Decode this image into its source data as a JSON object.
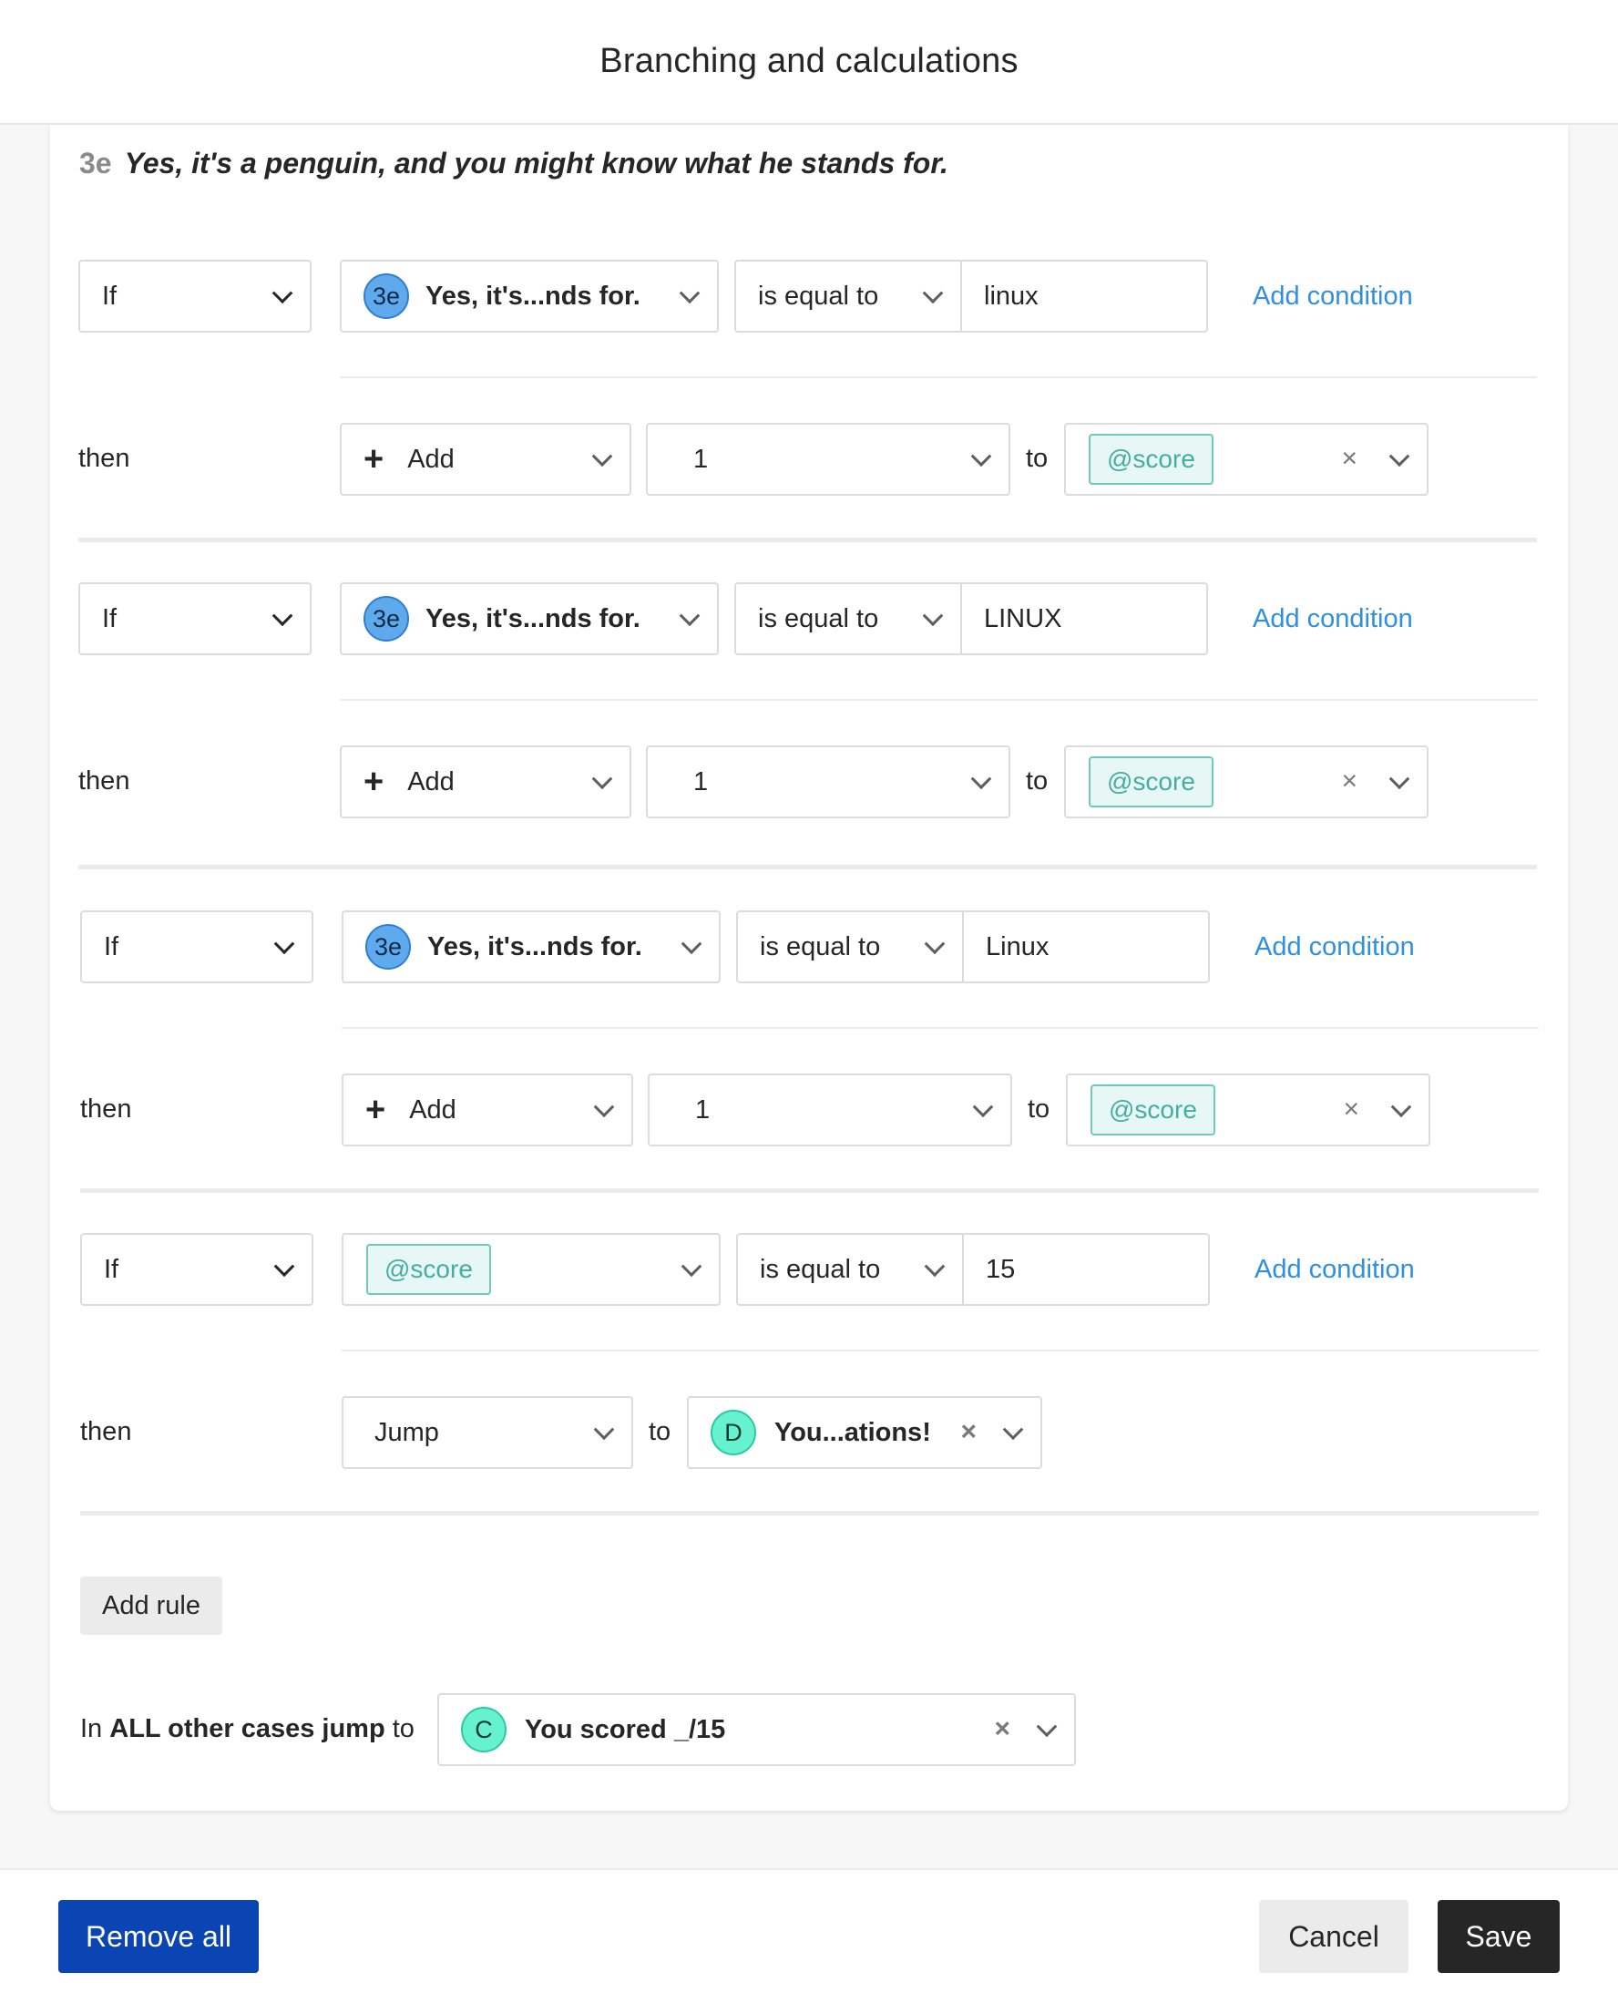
{
  "header": {
    "title": "Branching and calculations"
  },
  "question": {
    "ref": "3e",
    "text": "Yes, it's a penguin, and you might know what he stands for."
  },
  "rules": [
    {
      "if_label": "If",
      "subject": {
        "badge": "3e",
        "label": "Yes, it's...nds for."
      },
      "operator": "is equal to",
      "value": "linux",
      "add_condition": "Add condition",
      "then_label": "then",
      "action": {
        "plus": "+",
        "label": "Add"
      },
      "amount": "1",
      "to_label": "to",
      "target_var": "@score"
    },
    {
      "if_label": "If",
      "subject": {
        "badge": "3e",
        "label": "Yes, it's...nds for."
      },
      "operator": "is equal to",
      "value": "LINUX",
      "add_condition": "Add condition",
      "then_label": "then",
      "action": {
        "plus": "+",
        "label": "Add"
      },
      "amount": "1",
      "to_label": "to",
      "target_var": "@score"
    },
    {
      "if_label": "If",
      "subject": {
        "badge": "3e",
        "label": "Yes, it's...nds for."
      },
      "operator": "is equal to",
      "value": "Linux",
      "add_condition": "Add condition",
      "then_label": "then",
      "action": {
        "plus": "+",
        "label": "Add"
      },
      "amount": "1",
      "to_label": "to",
      "target_var": "@score"
    },
    {
      "if_label": "If",
      "subject_var": "@score",
      "operator": "is equal to",
      "value": "15",
      "add_condition": "Add condition",
      "then_label": "then",
      "action_label": "Jump",
      "to_label": "to",
      "jump_target": {
        "badge": "D",
        "label": "You...ations!"
      }
    }
  ],
  "add_rule": "Add rule",
  "fallback": {
    "prefix": "In",
    "bold": "ALL other cases jump",
    "suffix": "to",
    "target": {
      "badge": "C",
      "label": "You scored _/15"
    }
  },
  "icons": {
    "clear": "×"
  },
  "footer": {
    "remove_all": "Remove all",
    "cancel": "Cancel",
    "save": "Save"
  },
  "colors": {
    "primary": "#0b44b3",
    "link": "#2f8fe0",
    "variable": "#46ada0",
    "question_badge": "#5fa9ed",
    "ending_badge": "#66f2cf"
  }
}
